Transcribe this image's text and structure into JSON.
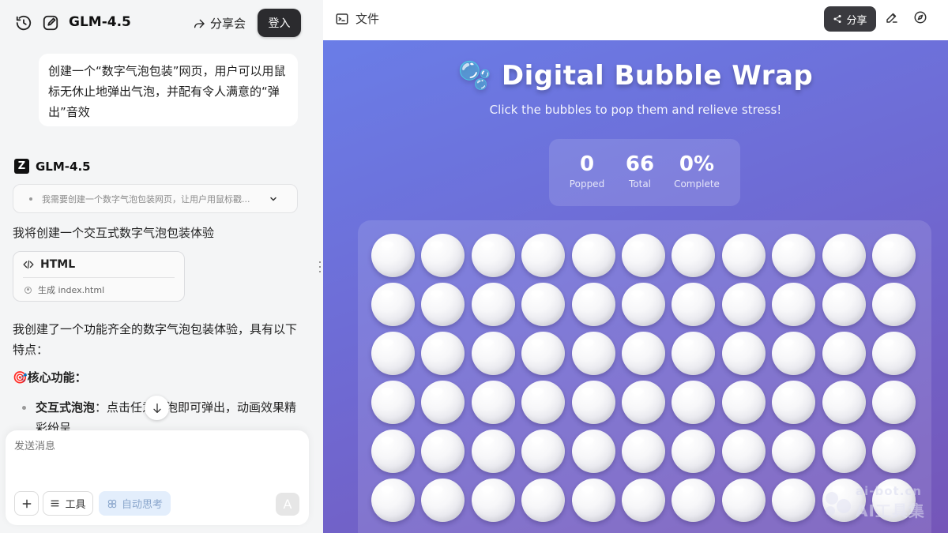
{
  "left": {
    "app_title": "GLM-4.5",
    "share_label": "分享会",
    "login_label": "登入",
    "user_message": "创建一个“数字气泡包装”网页，用户可以用鼠标无休止地弹出气泡，并配有令人满意的“弹出”音效",
    "assistant": {
      "logo_letter": "Z",
      "name": "GLM-4.5",
      "thinking_preview": "我需要创建一个数字气泡包装网页，让用户用鼠标戳...",
      "intro": "我将创建一个交互式数字气泡包装体验",
      "code_card": {
        "language": "HTML",
        "action": "生成 index.html"
      },
      "summary": "我创建了一个功能齐全的数字气泡包装体验，具有以下特点：",
      "features_heading": "🎯核心功能：",
      "bullet_bold": "交互式泡泡",
      "bullet_text": "：点击任意泡泡即可弹出，动画效果精彩纷呈"
    },
    "composer": {
      "placeholder": "发送消息",
      "tools_label": "工具",
      "auto_think_label": "自动思考",
      "send_icon": "A"
    }
  },
  "right": {
    "files_label": "文件",
    "share_label": "分享",
    "preview": {
      "title": "🫧 Digital Bubble Wrap",
      "subtitle": "Click the bubbles to pop them and relieve stress!",
      "stats": [
        {
          "value": "0",
          "label": "Popped"
        },
        {
          "value": "66",
          "label": "Total"
        },
        {
          "value": "0%",
          "label": "Complete"
        }
      ],
      "grid": {
        "rows": 6,
        "cols": 11
      }
    },
    "watermark": {
      "url": "ai-bot.cn",
      "name": "AI工具集"
    }
  },
  "colors": {
    "accent_dark": "#2b2b2e",
    "preview_gradient_start": "#6a7de7",
    "preview_gradient_end": "#7556b8"
  }
}
